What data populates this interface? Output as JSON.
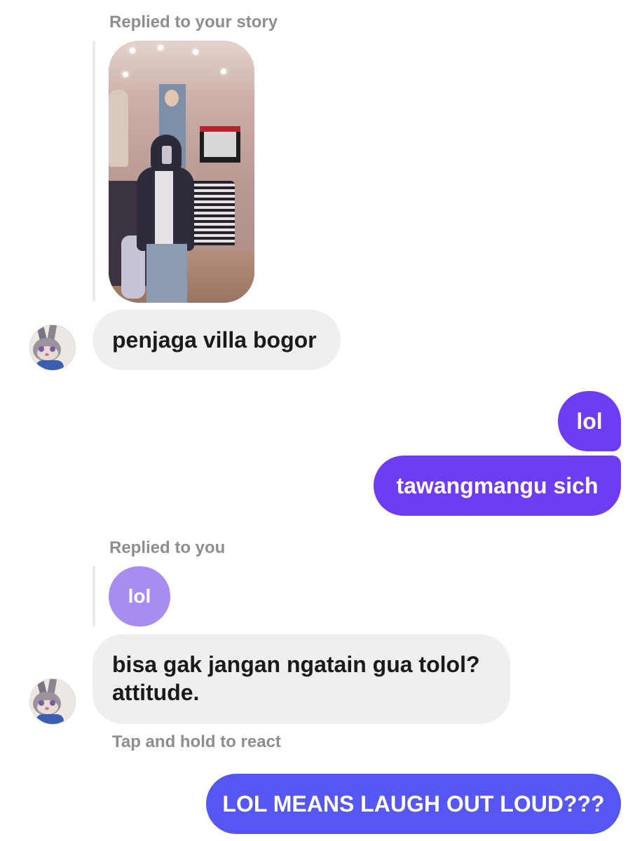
{
  "thread": {
    "story_reply_label": "Replied to your story",
    "message1": "penjaga villa bogor",
    "message2": "lol",
    "message3": "tawangmangu sich",
    "reply_to_you_label": "Replied to you",
    "quoted_message": "lol",
    "message4_line1": "bisa gak jangan ngatain gua tolol?",
    "message4_line2": "attitude.",
    "react_hint": "Tap and hold to react",
    "message5": "LOL MEANS LAUGH OUT LOUD???"
  },
  "icons": {
    "contact_avatar": "cartoon-bunny-avatar"
  },
  "colors": {
    "incoming_bubble": "#efefef",
    "outgoing_bubble": "#6f3cf5",
    "outgoing_bubble_last": "#5656f2",
    "quoted_bubble": "#a78df2",
    "meta_text": "#8e8e8e"
  }
}
